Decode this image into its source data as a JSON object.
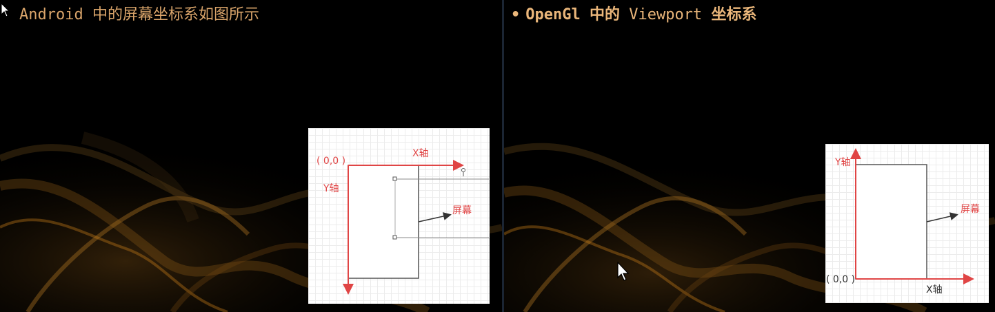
{
  "left_slide": {
    "heading": "Android 中的屏幕坐标系如图所示",
    "figure": {
      "origin_label": "( 0,0 )",
      "x_axis_label": "X轴",
      "y_axis_label": "Y轴",
      "screen_label": "屏幕"
    }
  },
  "right_slide": {
    "bullet": "•",
    "heading_part1": "OpenGl 中的",
    "heading_part2": "Viewport",
    "heading_part3": "坐标系",
    "figure": {
      "origin_label": "( 0,0 )",
      "x_axis_label": "X轴",
      "y_axis_label": "Y轴",
      "screen_label": "屏幕"
    }
  },
  "colors": {
    "heading_left": "#d9a46a",
    "heading_right": "#eab67a",
    "axis_red": "#e04545",
    "label_red": "#e04545",
    "frame_gray": "#555555"
  },
  "icons": [
    "mouse-cursor-icon",
    "mouse-cursor-icon"
  ]
}
